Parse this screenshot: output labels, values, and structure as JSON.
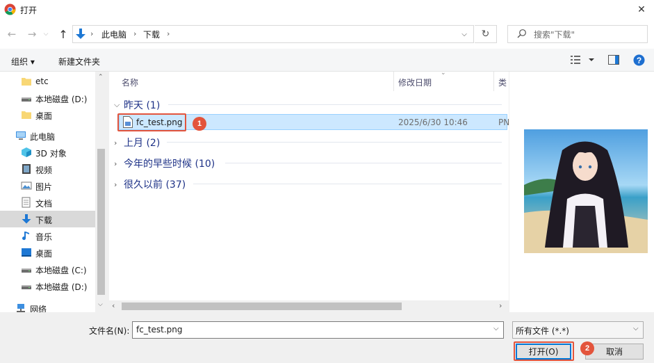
{
  "window": {
    "title": "打开",
    "close": "✕"
  },
  "nav": {
    "breadcrumb": [
      "此电脑",
      "下载"
    ],
    "search_placeholder": "搜索\"下载\""
  },
  "toolbar": {
    "organize": "组织 ▾",
    "new_folder": "新建文件夹"
  },
  "sidebar": {
    "items": [
      {
        "label": "etc",
        "icon": "folder-icon"
      },
      {
        "label": "本地磁盘 (D:)",
        "icon": "drive-icon"
      },
      {
        "label": "桌面",
        "icon": "folder-icon"
      },
      {
        "label": "此电脑",
        "icon": "computer-icon"
      },
      {
        "label": "3D 对象",
        "icon": "3d-objects-icon"
      },
      {
        "label": "视频",
        "icon": "video-icon"
      },
      {
        "label": "图片",
        "icon": "pictures-icon"
      },
      {
        "label": "文档",
        "icon": "documents-icon"
      },
      {
        "label": "下载",
        "icon": "download-icon",
        "selected": true
      },
      {
        "label": "音乐",
        "icon": "music-icon"
      },
      {
        "label": "桌面",
        "icon": "desktop-icon"
      },
      {
        "label": "本地磁盘 (C:)",
        "icon": "drive-icon"
      },
      {
        "label": "本地磁盘 (D:)",
        "icon": "drive-icon"
      },
      {
        "label": "网络",
        "icon": "network-icon"
      }
    ]
  },
  "columns": {
    "name": "名称",
    "modified": "修改日期",
    "type": "类"
  },
  "groups": [
    {
      "label": "昨天 (1)",
      "expanded": true
    },
    {
      "label": "上月 (2)",
      "expanded": false
    },
    {
      "label": "今年的早些时候 (10)",
      "expanded": false
    },
    {
      "label": "很久以前 (37)",
      "expanded": false
    }
  ],
  "file": {
    "name": "fc_test.png",
    "modified": "2025/6/30 10:46",
    "type": "PN"
  },
  "bottom": {
    "filename_label": "文件名(N):",
    "filename_value": "fc_test.png",
    "filetype": "所有文件 (*.*)",
    "open": "打开(O)",
    "cancel": "取消"
  },
  "annotations": {
    "step1": "1",
    "step2": "2"
  },
  "colors": {
    "accent": "#0078d7",
    "annotation": "#e3543c",
    "selection": "#cce8ff",
    "group": "#1e3287"
  }
}
